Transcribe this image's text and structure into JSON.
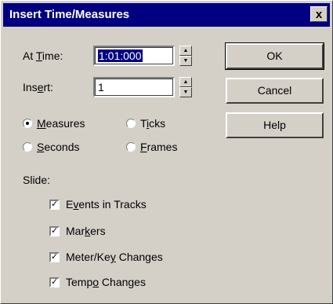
{
  "window": {
    "title": "Insert Time/Measures",
    "close_glyph": "x"
  },
  "fields": {
    "at_time": {
      "label_pre": "At ",
      "label_ul": "T",
      "label_post": "ime:",
      "value": "1:01:000"
    },
    "insert": {
      "label_pre": "Ins",
      "label_ul": "e",
      "label_post": "rt:",
      "value": "1"
    }
  },
  "buttons": {
    "ok": "OK",
    "cancel": "Cancel",
    "help": "Help"
  },
  "units": [
    {
      "pre": "",
      "ul": "M",
      "post": "easures",
      "selected": true
    },
    {
      "pre": "T",
      "ul": "i",
      "post": "cks",
      "selected": false
    },
    {
      "pre": "",
      "ul": "S",
      "post": "econds",
      "selected": false
    },
    {
      "pre": "",
      "ul": "F",
      "post": "rames",
      "selected": false
    }
  ],
  "slide": {
    "label": "Slide:",
    "options": [
      {
        "pre": "E",
        "ul": "v",
        "post": "ents in Tracks",
        "checked": true
      },
      {
        "pre": "Mar",
        "ul": "k",
        "post": "ers",
        "checked": true
      },
      {
        "pre": "Meter/Ke",
        "ul": "y",
        "post": " Changes",
        "checked": true
      },
      {
        "pre": "Temp",
        "ul": "o",
        "post": " Changes",
        "checked": true
      }
    ]
  }
}
